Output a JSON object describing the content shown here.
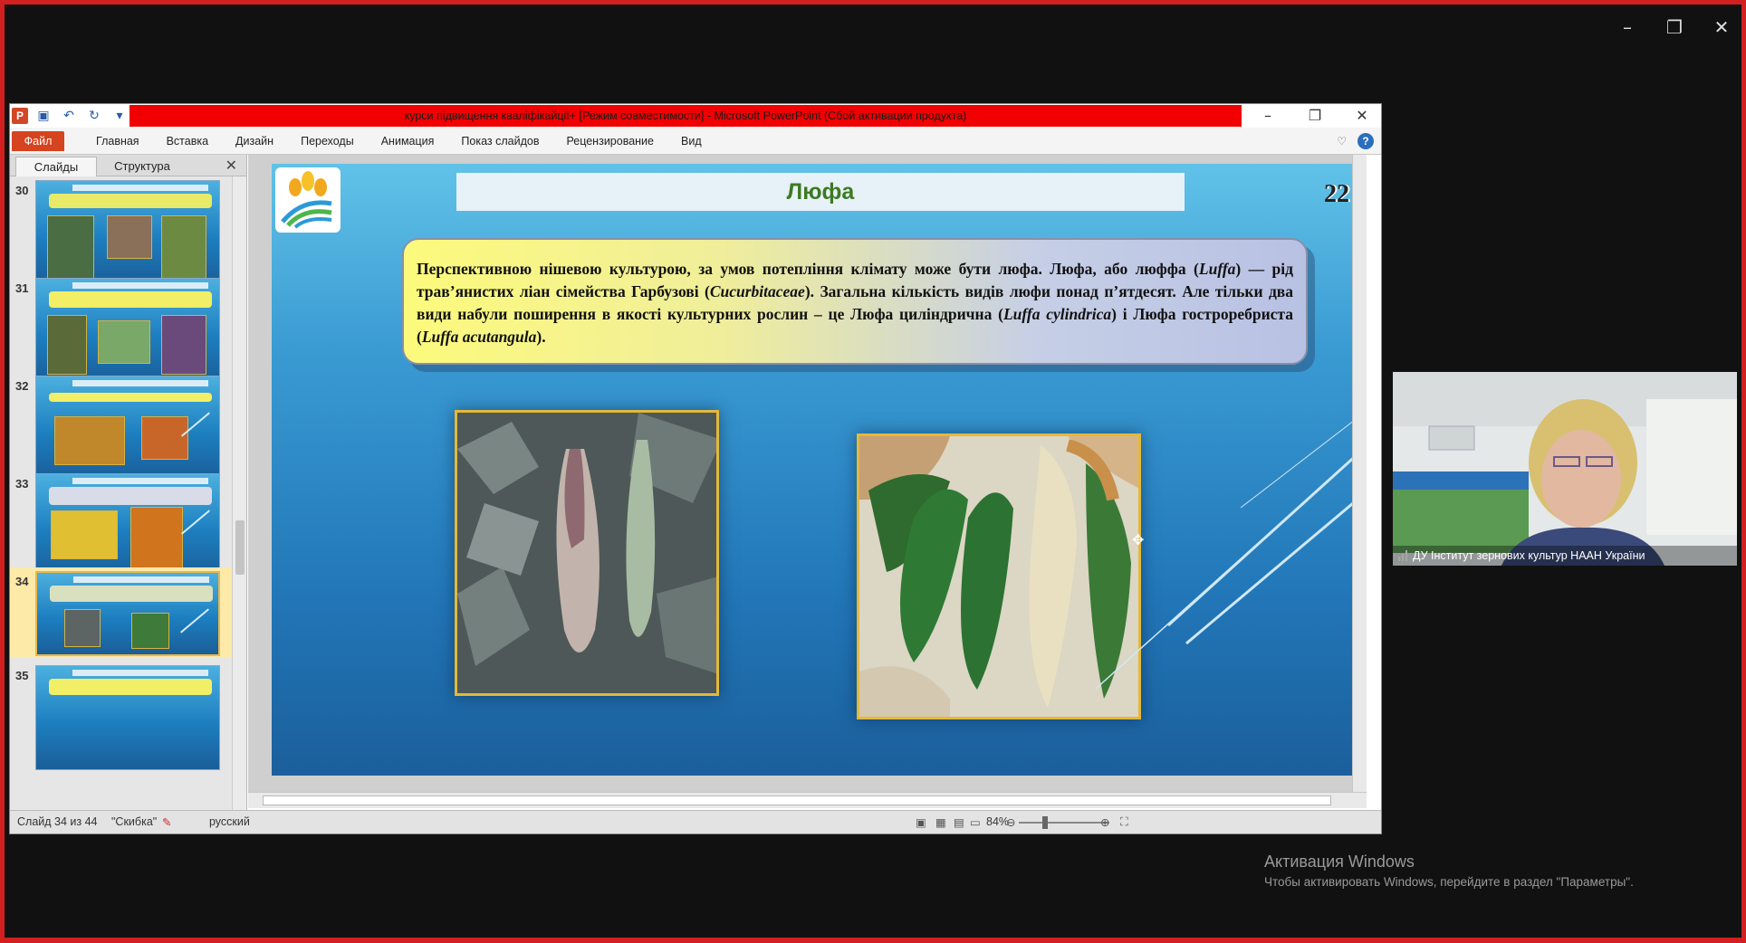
{
  "window": {
    "controls": [
      "minimize",
      "restore",
      "close"
    ]
  },
  "ppt": {
    "title": "курси підвищення кваліфікайції+ [Режим совместимости] - Microsoft PowerPoint (Сбой активации продукта)",
    "ribbon": {
      "file_tab": "Файл",
      "tabs": [
        "Главная",
        "Вставка",
        "Дизайн",
        "Переходы",
        "Анимация",
        "Показ слайдов",
        "Рецензирование",
        "Вид"
      ]
    },
    "pane": {
      "tab_slides": "Слайды",
      "tab_outline": "Структура",
      "thumbnails": [
        {
          "num": "30"
        },
        {
          "num": "31"
        },
        {
          "num": "32"
        },
        {
          "num": "33"
        },
        {
          "num": "34",
          "selected": true
        },
        {
          "num": "35"
        }
      ]
    },
    "slide": {
      "title": "Люфа",
      "number": "22",
      "text_parts": [
        "Перспективною нішевою культурою, за умов потепління клімату може бути люфа. Люфа, або люффа (",
        "Luffa",
        ") — рід трав’янистих ліан сімейства Гарбузові (",
        "Cucurbitaceae",
        "). Загальна кількість видів люфи понад п’ятдесят. Але тільки два види набули поширення в якості культурних рослин – це Люфа циліндрична (",
        "Luffa cylindrica",
        ") і Люфа гостроребриста (",
        "Luffa acutangula",
        ")."
      ]
    },
    "status": {
      "slide_info": "Слайд 34 из 44",
      "theme": "\"Скибка\"",
      "language": "русский",
      "zoom": "84%"
    }
  },
  "webcam": {
    "name": "ДУ Інститут зернових культур НААН України"
  },
  "activation": {
    "title": "Активация Windows",
    "subtitle": "Чтобы активировать Windows, перейдите в раздел \"Параметры\"."
  }
}
